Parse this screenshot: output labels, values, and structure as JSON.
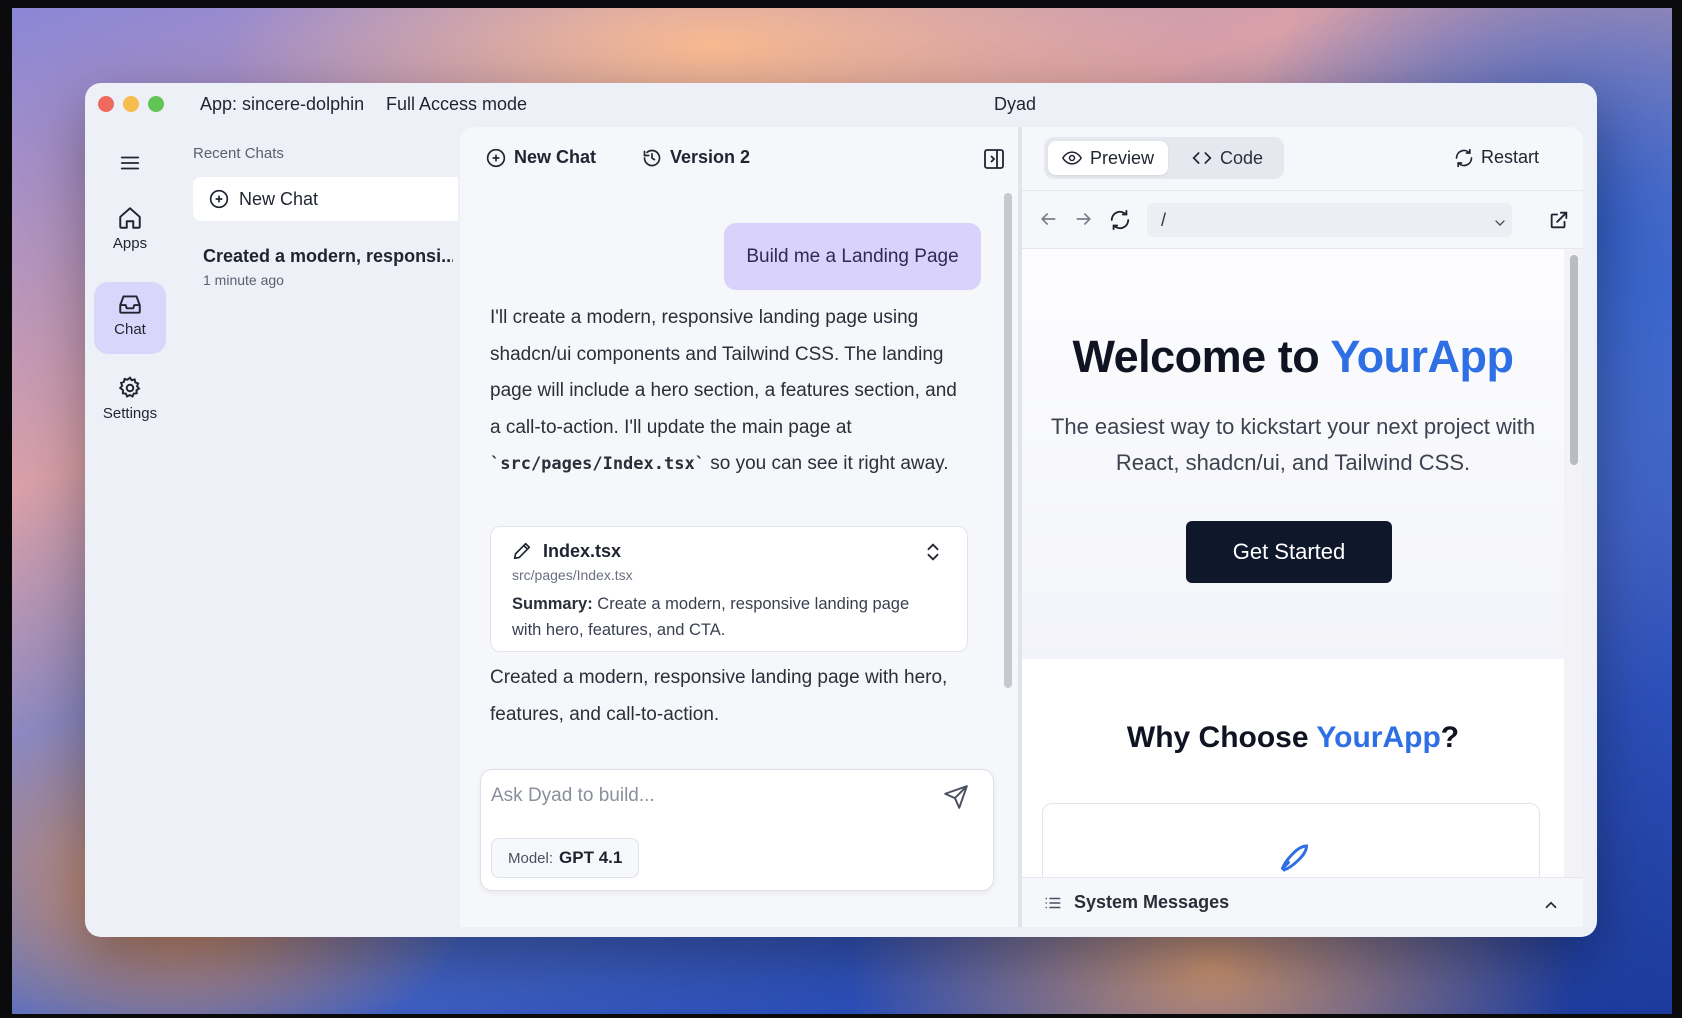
{
  "window": {
    "app_label": "App: sincere-dolphin",
    "mode": "Full Access mode",
    "title": "Dyad"
  },
  "nav": [
    {
      "label": "Apps",
      "icon": "home-icon"
    },
    {
      "label": "Chat",
      "icon": "inbox-icon",
      "active": true
    },
    {
      "label": "Settings",
      "icon": "gear-icon"
    }
  ],
  "sidebar": {
    "heading": "Recent Chats",
    "new_chat": "New Chat",
    "chats": [
      {
        "title": "Created a modern, responsi...",
        "time": "1 minute ago"
      }
    ]
  },
  "chat": {
    "new_chat": "New Chat",
    "version": "Version 2",
    "user_message": "Build me a Landing Page",
    "assistant_intro": "I'll create a modern, responsive landing page using shadcn/ui components and Tailwind CSS. The landing page will include a hero section, a features section, and a call-to-action. I'll update the main page at",
    "assistant_code": "`src/pages/Index.tsx`",
    "assistant_outro": "so you can see it right away.",
    "file": {
      "name": "Index.tsx",
      "path": "src/pages/Index.tsx",
      "summary_label": "Summary:",
      "summary": "Create a modern, responsive landing page with hero, features, and CTA."
    },
    "final_message": "Created a modern, responsive landing page with hero, features, and call-to-action.",
    "input_placeholder": "Ask Dyad to build...",
    "model_label": "Model:",
    "model_value": "GPT 4.1"
  },
  "preview": {
    "tab_preview": "Preview",
    "tab_code": "Code",
    "restart": "Restart",
    "url": "/",
    "hero_title_prefix": "Welcome to ",
    "hero_title_accent": "YourApp",
    "hero_subtitle": "The easiest way to kickstart your next project with React, shadcn/ui, and Tailwind CSS.",
    "cta": "Get Started",
    "why_prefix": "Why Choose ",
    "why_accent": "YourApp",
    "why_suffix": "?",
    "system_messages": "System Messages"
  },
  "colors": {
    "accent": "#2f6fe4",
    "active_nav": "#d9d6fb",
    "user_bubble": "#d9d3fb",
    "cta_bg": "#0f172a"
  }
}
